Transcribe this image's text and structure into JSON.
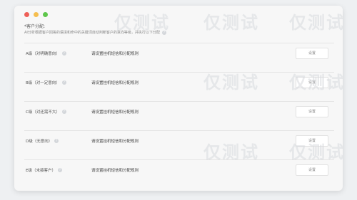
{
  "section": {
    "title": "*客户分配:",
    "description": "AI分析根据客户回答的语境和命中的关键词自动判断客户的意向等级，并执行以下分配"
  },
  "rows": [
    {
      "level": "A级（对明确意向）",
      "rule": "请设置挂机短信和分配规则",
      "button": "设置"
    },
    {
      "level": "B级（对一定意向）",
      "rule": "请设置挂机短信和分配规则",
      "button": "设置"
    },
    {
      "level": "C级（对还需不大）",
      "rule": "请设置挂机短信和分配规则",
      "button": "设置"
    },
    {
      "level": "D级（无意向）",
      "rule": "请设置挂机短信和分配规则",
      "button": "设置"
    },
    {
      "level": "E级（未接客户）",
      "rule": "请设置挂机短信和分配规则",
      "button": "设置"
    }
  ],
  "watermark": "仅测试"
}
